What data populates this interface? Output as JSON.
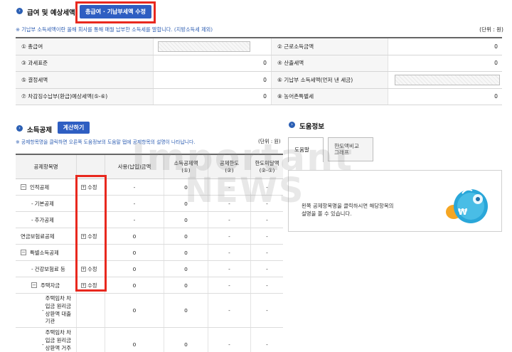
{
  "section1": {
    "title": "급여 및 예상세액",
    "button": "총급여 · 기납부세액 수정",
    "note": "※ 기납부 소득세액이란 올해 회사를 통해 매월 납부한 소득세를 말합니다. (지방소득세 제외)",
    "unit": "(단위 : 원)",
    "rows": [
      {
        "left_label": "① 총급여",
        "left_value": "",
        "right_label": "② 근로소득금액",
        "right_value": "0"
      },
      {
        "left_label": "③ 과세표준",
        "left_value": "0",
        "right_label": "④ 산출세액",
        "right_value": "0"
      },
      {
        "left_label": "⑤ 결정세액",
        "left_value": "0",
        "right_label": "⑥ 기납부 소득세액(먼저 낸 세금)",
        "right_value": ""
      },
      {
        "left_label": "⑦ 차감징수납부(환급)예상세액(⑤-⑥)",
        "left_value": "0",
        "right_label": "⑧ 농어촌특별세",
        "right_value": "0"
      }
    ]
  },
  "section2": {
    "title": "소득공제",
    "button": "계산하기",
    "note": "※ 공제항목명을 클릭하면 오른쪽 도움정보의 도움말 탭에 공제항목의 설명이 나타납니다.",
    "unit": "(단위 : 원)",
    "headers": [
      "공제항목명",
      "",
      "사용(납입)금액",
      "소득공제액\n(①)",
      "공제한도\n(②)",
      "한도미달액\n(②-①)"
    ],
    "rows": [
      {
        "name": "인적공제",
        "toggle": "−",
        "indent": 0,
        "edit": "수정",
        "amount": "-",
        "deduction": "0",
        "limit": "-",
        "shortfall": "-"
      },
      {
        "name": "기본공제",
        "toggle": "",
        "indent": 1,
        "edit": "",
        "amount": "-",
        "deduction": "0",
        "limit": "-",
        "shortfall": "-"
      },
      {
        "name": "추가공제",
        "toggle": "",
        "indent": 1,
        "edit": "",
        "amount": "-",
        "deduction": "0",
        "limit": "-",
        "shortfall": "-"
      },
      {
        "name": "연금보험료공제",
        "toggle": "",
        "indent": 0,
        "edit": "수정",
        "amount": "0",
        "deduction": "0",
        "limit": "-",
        "shortfall": "-"
      },
      {
        "name": "특별소득공제",
        "toggle": "−",
        "indent": 0,
        "edit": "",
        "amount": "0",
        "deduction": "0",
        "limit": "-",
        "shortfall": "-"
      },
      {
        "name": "건강보험료 등",
        "toggle": "",
        "indent": 1,
        "edit": "수정",
        "amount": "0",
        "deduction": "0",
        "limit": "-",
        "shortfall": "-"
      },
      {
        "name": "주택자금",
        "toggle": "−",
        "indent": 1,
        "edit": "수정",
        "amount": "0",
        "deduction": "0",
        "limit": "-",
        "shortfall": "-"
      },
      {
        "name": "주택임차 차입금 원리금 상환액 대출기관",
        "toggle": "",
        "indent": 2,
        "edit": "",
        "amount": "0",
        "deduction": "0",
        "limit": "-",
        "shortfall": "-"
      },
      {
        "name": "주택임차 차입금 원리금 상환액 거주자",
        "toggle": "",
        "indent": 2,
        "edit": "",
        "amount": "0",
        "deduction": "0",
        "limit": "-",
        "shortfall": "-"
      }
    ]
  },
  "help": {
    "title": "도움정보",
    "tabs": [
      "도움말",
      "한도액비교\n그래프"
    ],
    "text": "왼쪽 공제항목명을 클릭하시면 해당항목의\n설명을 볼 수 있습니다."
  },
  "watermark": "Important NEWS",
  "colors": {
    "accent": "#2e5ec2",
    "highlight": "#e8281e",
    "note": "#2f5fb3"
  }
}
